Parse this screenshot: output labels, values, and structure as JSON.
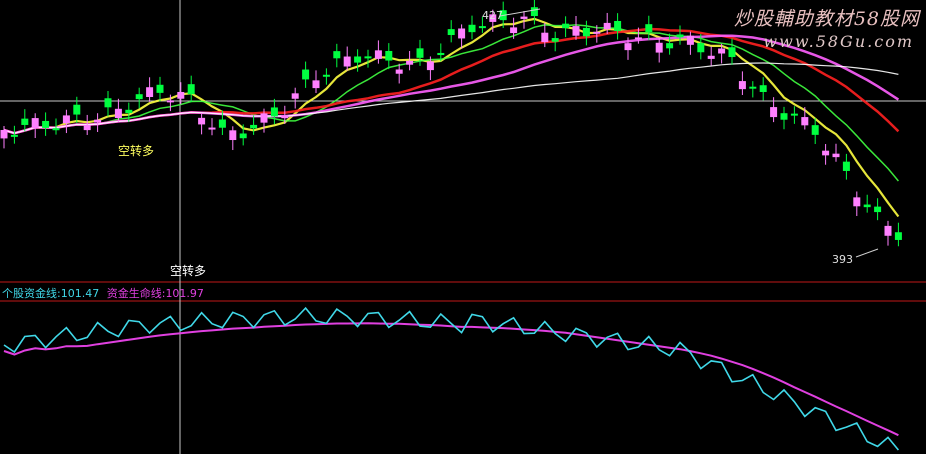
{
  "watermark": {
    "title": "炒股輔助教材58股网",
    "url": "www.58Gu.com"
  },
  "indicator": {
    "line1_name": "个股资金线:",
    "line1_value": "101.47",
    "line2_name": "资金生命线:",
    "line2_value": "101.97",
    "line1_color": "#40d8e8",
    "line2_color": "#e040e0"
  },
  "chart_data": [
    {
      "type": "candlestick",
      "panel": "price",
      "annotations": [
        {
          "text": "427",
          "note": "peak high marker"
        },
        {
          "text": "393",
          "note": "low marker"
        },
        {
          "text": "空转多",
          "note": "signal label (yellow)"
        },
        {
          "text": "空转多",
          "note": "signal label at crosshair (white)"
        }
      ],
      "up_color": "#ff80ff",
      "down_color": "#00ff40",
      "ma_colors": [
        "#ffff40",
        "#40ff40",
        "#ff2020",
        "#ff60ff",
        "#ffffff"
      ],
      "approx_high": 427,
      "approx_low": 393
    },
    {
      "type": "line",
      "panel": "indicator",
      "series": [
        {
          "name": "个股资金线",
          "color": "#40d8e8",
          "last": 101.47
        },
        {
          "name": "资金生命线",
          "color": "#e040e0",
          "last": 101.97
        }
      ]
    }
  ]
}
